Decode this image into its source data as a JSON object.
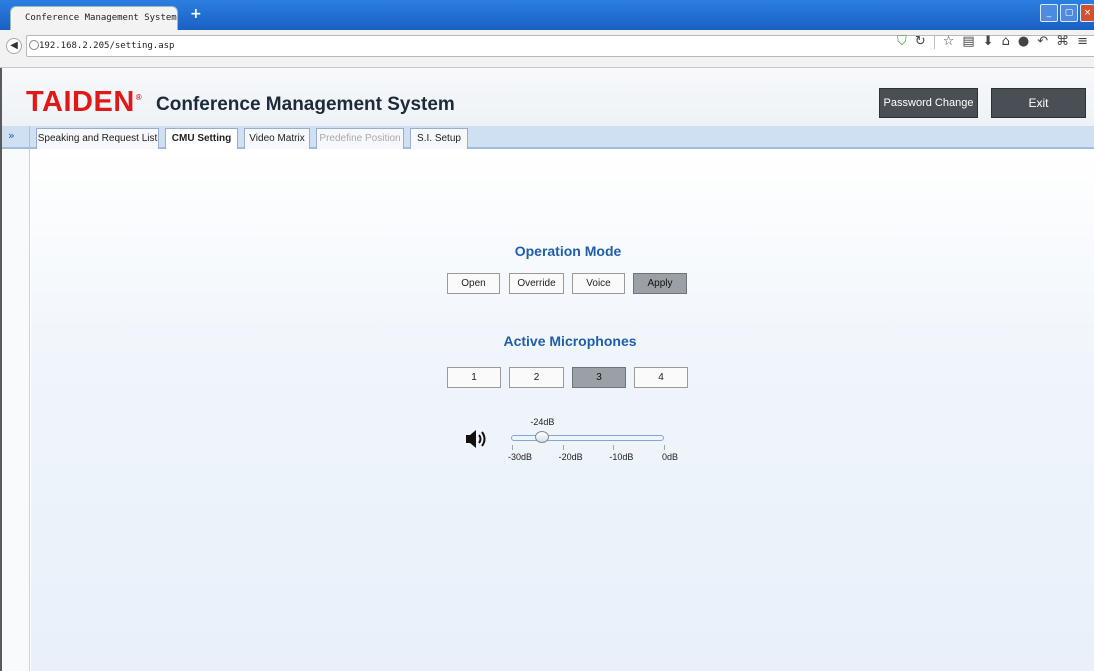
{
  "browser": {
    "tab_title": "Conference Management System",
    "new_tab": "+",
    "url": "192.168.2.205/setting.asp"
  },
  "header": {
    "logo": "TAIDEN",
    "logo_mark": "®",
    "title": "Conference Management System",
    "password_change": "Password Change",
    "exit": "Exit"
  },
  "tabs": [
    {
      "label": "Speaking and Request List",
      "state": "normal"
    },
    {
      "label": "CMU Setting",
      "state": "active"
    },
    {
      "label": "Video Matrix",
      "state": "normal"
    },
    {
      "label": "Predefine Position",
      "state": "disabled"
    },
    {
      "label": "S.I. Setup",
      "state": "normal"
    }
  ],
  "operation_mode": {
    "title": "Operation Mode",
    "buttons": [
      "Open",
      "Override",
      "Voice",
      "Apply"
    ],
    "selected": "Apply"
  },
  "active_microphones": {
    "title": "Active Microphones",
    "buttons": [
      "1",
      "2",
      "3",
      "4"
    ],
    "selected": "3"
  },
  "volume": {
    "value_label": "-24dB",
    "value_db": -24,
    "min_db": -30,
    "max_db": 0,
    "ticks": [
      "-30dB",
      "-20dB",
      "-10dB",
      "0dB"
    ]
  },
  "icons": {
    "back": "arrow-left-icon",
    "speaker": "speaker-icon",
    "expand": "double-chevron-right-icon"
  },
  "colors": {
    "logo": "#e01818",
    "section_title": "#1f5fa8",
    "browser_titlebar": "#1b5fc4",
    "selected_button": "#9ba0a7"
  }
}
